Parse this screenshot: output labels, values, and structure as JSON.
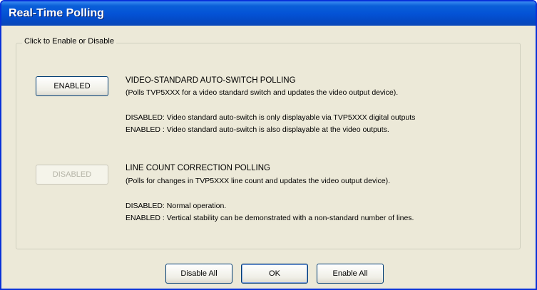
{
  "window": {
    "title": "Real-Time Polling"
  },
  "group": {
    "legend": "Click to Enable or Disable"
  },
  "options": [
    {
      "state_label": "ENABLED",
      "title": "VIDEO-STANDARD AUTO-SWITCH POLLING",
      "description": "(Polls TVP5XXX for a video standard switch and updates the video output device).",
      "disabled_note": "DISABLED: Video standard auto-switch is only displayable via TVP5XXX digital outputs",
      "enabled_note": "ENABLED : Video standard auto-switch is also displayable at the video outputs."
    },
    {
      "state_label": "DISABLED",
      "title": "LINE COUNT CORRECTION POLLING",
      "description": "(Polls for changes in TVP5XXX line count and updates the video output device).",
      "disabled_note": "DISABLED: Normal operation.",
      "enabled_note": "ENABLED : Vertical stability can be demonstrated with a non-standard number of lines."
    }
  ],
  "footer": {
    "disable_all_label": "Disable All",
    "ok_label": "OK",
    "enable_all_label": "Enable All"
  }
}
